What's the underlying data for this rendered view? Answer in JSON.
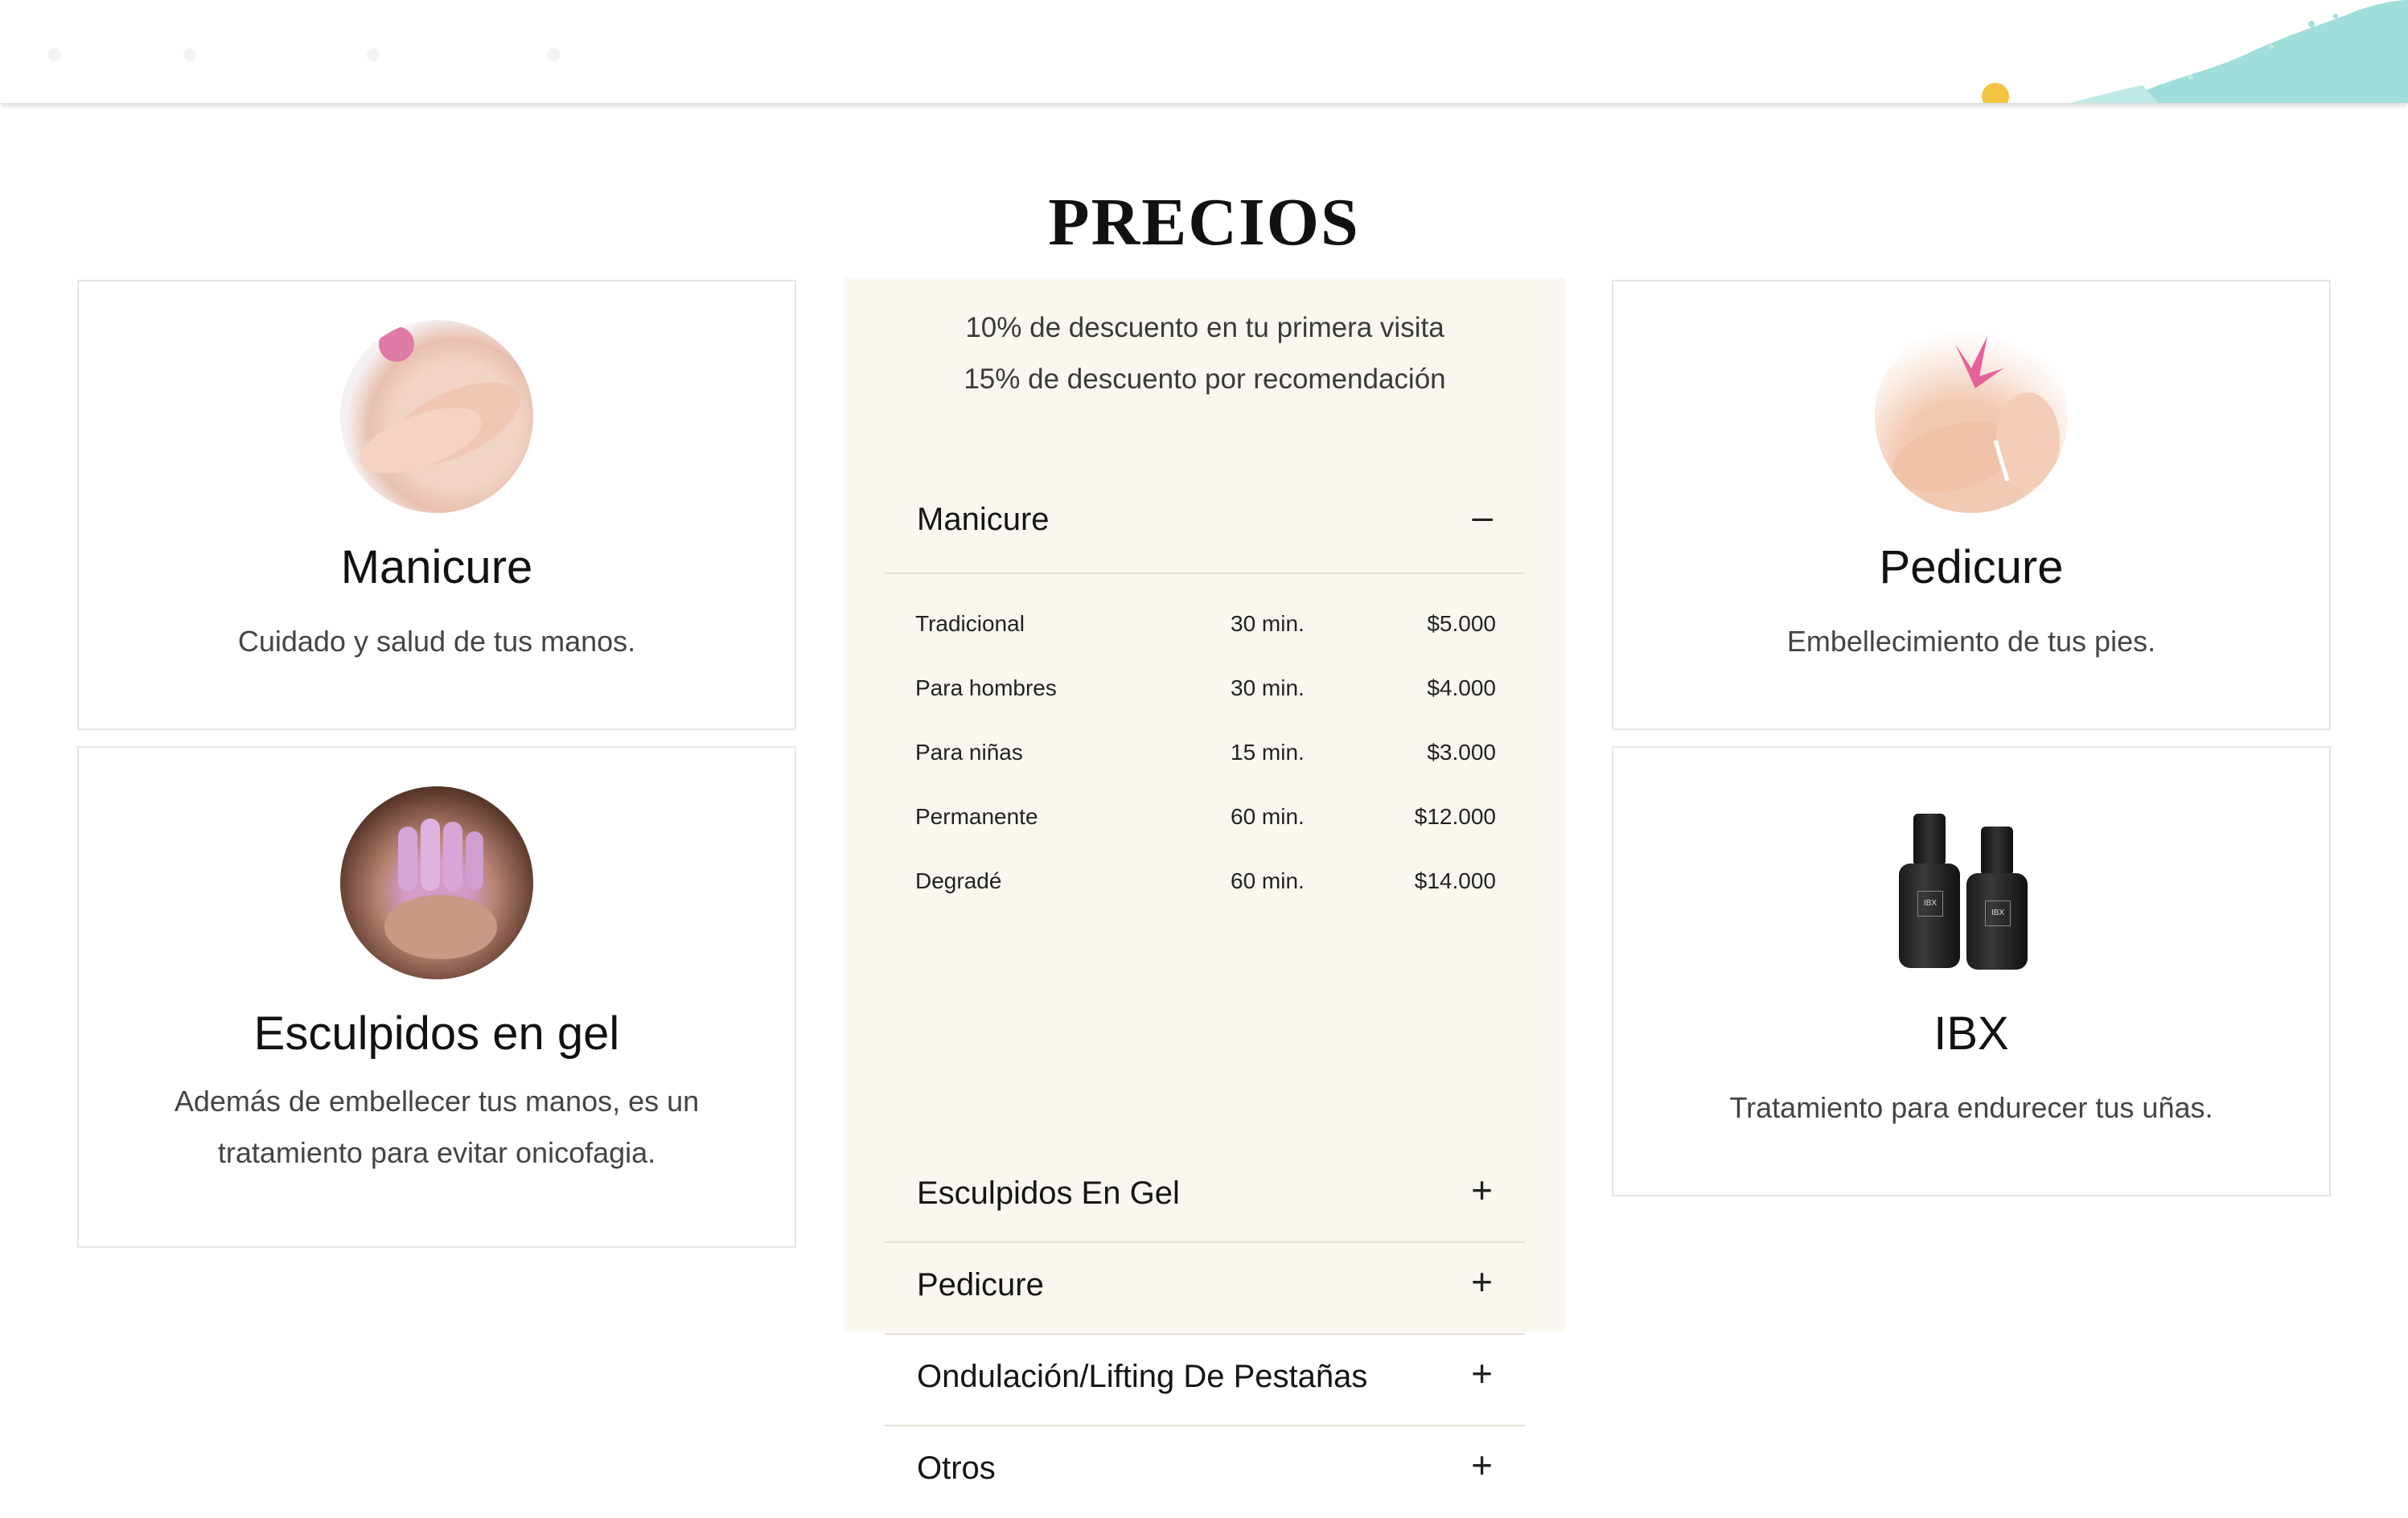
{
  "page": {
    "title": "PRECIOS"
  },
  "cards": {
    "manicure": {
      "name": "Manicure",
      "desc": "Cuidado y salud de tus manos."
    },
    "gel": {
      "name": "Esculpidos en gel",
      "desc": "Además de embellecer tus manos, es un tratamiento para evitar onicofagia."
    },
    "pedicure": {
      "name": "Pedicure",
      "desc": "Embellecimiento de tus pies."
    },
    "ibx": {
      "name": "IBX",
      "desc": "Tratamiento para endurecer tus uñas.",
      "bottle_label_1": "IBX",
      "bottle_label_2": "IBX"
    }
  },
  "pricing": {
    "promo_1": "10% de descuento en tu primera visita",
    "promo_2": "15% de descuento por recomendación",
    "sections": [
      {
        "label": "Manicure",
        "sign": "–",
        "expanded": true
      },
      {
        "label": "Esculpidos En Gel",
        "sign": "+",
        "expanded": false
      },
      {
        "label": "Pedicure",
        "sign": "+",
        "expanded": false
      },
      {
        "label": "Ondulación/Lifting De Pestañas",
        "sign": "+",
        "expanded": false
      },
      {
        "label": "Otros",
        "sign": "+",
        "expanded": false
      }
    ],
    "manicure_rows": [
      {
        "service": "Tradicional",
        "duration": "30 min.",
        "price": "$5.000"
      },
      {
        "service": "Para hombres",
        "duration": "30 min.",
        "price": "$4.000"
      },
      {
        "service": "Para niñas",
        "duration": "15 min.",
        "price": "$3.000"
      },
      {
        "service": "Permanente",
        "duration": "60 min.",
        "price": "$12.000"
      },
      {
        "service": "Degradé",
        "duration": "60 min.",
        "price": "$14.000"
      }
    ]
  },
  "colors": {
    "panel_bg": "#f9f7f0",
    "brush_accent": "#9fdedb",
    "dot_accent": "#f4c542"
  }
}
